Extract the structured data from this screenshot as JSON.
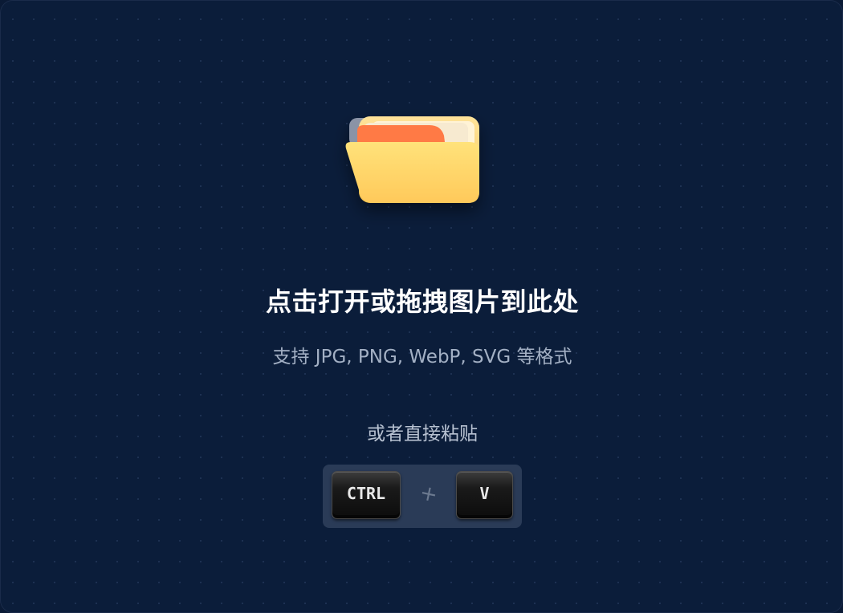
{
  "dropzone": {
    "icon": "open-folder-icon",
    "title": "点击打开或拖拽图片到此处",
    "formats": "支持 JPG, PNG, WebP, SVG 等格式",
    "paste_hint": "或者直接粘贴",
    "shortcut": {
      "key1": "CTRL",
      "separator": "+",
      "key2": "V"
    }
  },
  "colors": {
    "background": "#0b1d3a",
    "folder_body": "#ffd25e",
    "folder_tab": "#ff7a45",
    "key": "#151515"
  }
}
